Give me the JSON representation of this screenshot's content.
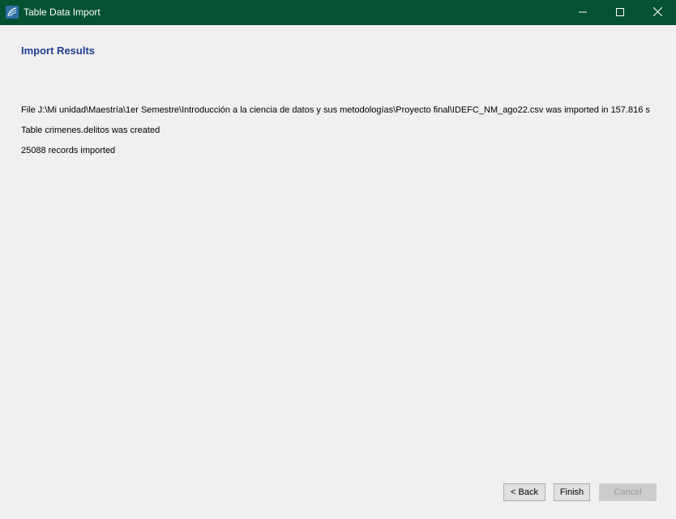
{
  "window": {
    "title": "Table Data Import",
    "controls": {
      "minimize": "minimize-icon",
      "maximize": "maximize-icon",
      "close": "close-icon"
    },
    "titlebar_color": "#045232"
  },
  "page": {
    "heading": "Import Results",
    "heading_color": "#1f3f8f",
    "results": [
      "File J:\\Mi unidad\\Maestría\\1er Semestre\\Introducción a la ciencia de datos y sus metodologías\\Proyecto final\\IDEFC_NM_ago22.csv was imported in 157.816 s",
      "Table crimenes.delitos was created",
      "25088 records imported"
    ]
  },
  "buttons": {
    "back": "< Back",
    "finish": "Finish",
    "cancel": "Cancel"
  }
}
